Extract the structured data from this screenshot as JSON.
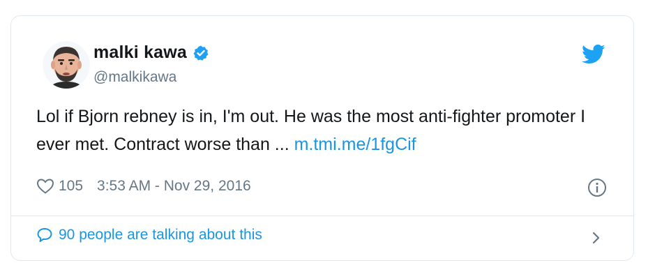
{
  "author": {
    "display_name": "malki kawa",
    "handle": "@malkikawa"
  },
  "tweet": {
    "text": "Lol if Bjorn rebney is in, I'm out. He was the most anti-fighter promoter I ever met. Contract worse than ... ",
    "link": "m.tmi.me/1fgCif",
    "likes": "105",
    "timestamp": "3:53 AM - Nov 29, 2016"
  },
  "conversation": {
    "label": "90 people are talking about this"
  },
  "icons": {
    "verified": "verified-badge-icon",
    "brand": "twitter-bird-icon",
    "like": "heart-icon",
    "info": "info-icon",
    "conversation": "speech-bubble-icon",
    "chevron": "chevron-right-icon"
  },
  "colors": {
    "accent": "#1b95e0",
    "text": "#14171a",
    "secondary": "#657786",
    "border": "#e1e8ed"
  }
}
